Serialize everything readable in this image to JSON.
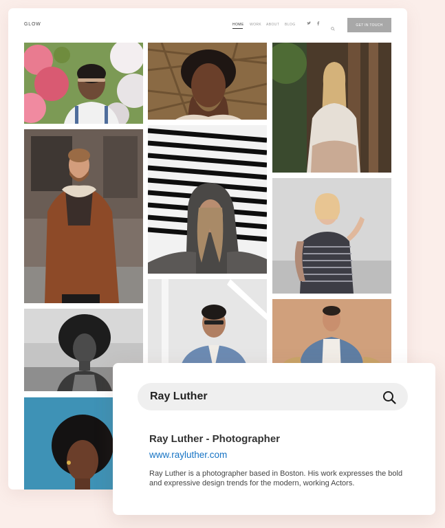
{
  "site": {
    "logo": "GLOW",
    "nav": [
      "HOME",
      "WORK",
      "ABOUT",
      "BLOG"
    ],
    "cta_label": "GET IN TOUCH"
  },
  "gallery": {
    "photos": [
      "woman-with-flowers",
      "woman-hands-on-face",
      "woman-in-forest",
      "man-brown-jacket",
      "hooded-person-blinds",
      "woman-tattoo-tank",
      "woman-afro-bw",
      "man-sunglasses-denim",
      "man-armchair",
      "woman-afro-teal"
    ]
  },
  "search_card": {
    "query": "Ray Luther",
    "result_title": "Ray Luther - Photographer",
    "result_url": "www.rayluther.com",
    "result_description": "Ray Luther is a photographer based in Boston. His work expresses the bold and expressive design trends for the modern, working Actors."
  },
  "icons": {
    "search": "search-icon",
    "twitter": "twitter-icon",
    "facebook": "facebook-icon"
  },
  "colors": {
    "background": "#fbeeea",
    "cta": "#a8a8a8",
    "link": "#1673c4"
  }
}
